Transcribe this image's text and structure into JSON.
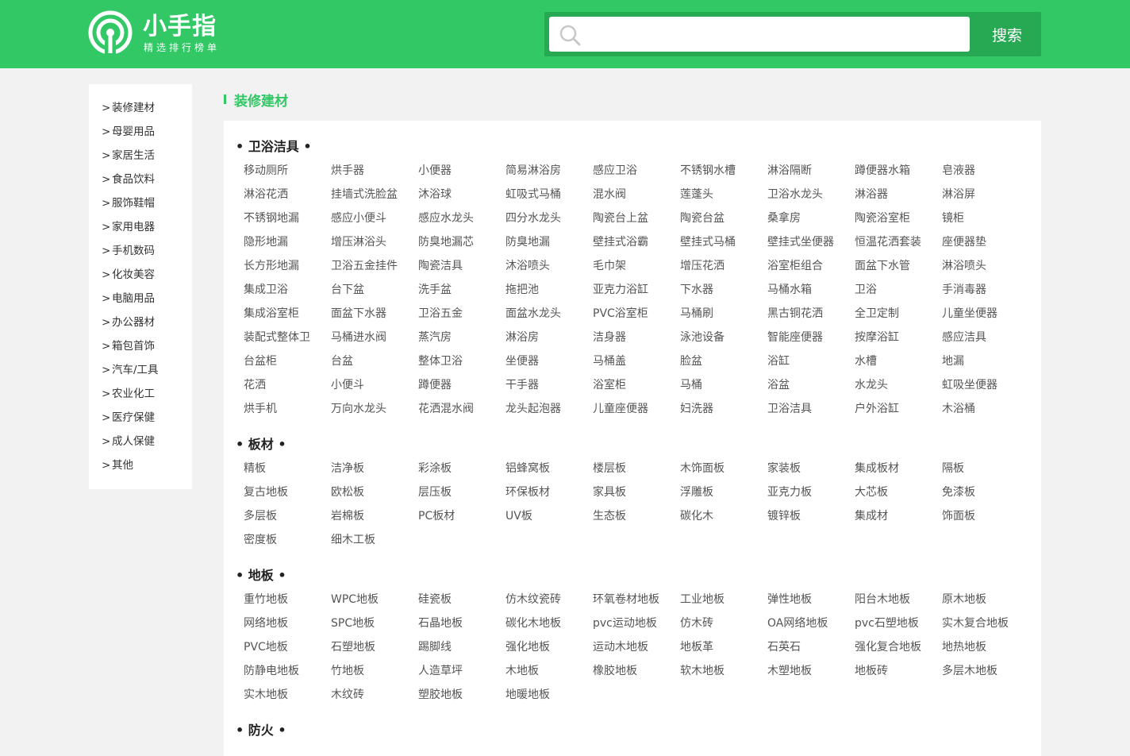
{
  "header": {
    "logo_title": "小手指",
    "logo_subtitle": "精选排行榜单",
    "search_placeholder": "",
    "search_button": "搜索",
    "colors": {
      "brand": "#31c865",
      "brand_dark": "#27a853"
    }
  },
  "sidebar": {
    "chevron": ">",
    "items": [
      "装修建材",
      "母婴用品",
      "家居生活",
      "食品饮料",
      "服饰鞋帽",
      "家用电器",
      "手机数码",
      "化妆美容",
      "电脑用品",
      "办公器材",
      "箱包首饰",
      "汽车/工具",
      "农业化工",
      "医疗保健",
      "成人保健",
      "其他"
    ]
  },
  "category_title": "装修建材",
  "sections": [
    {
      "title": "卫浴洁具",
      "items": [
        "移动厕所",
        "烘手器",
        "小便器",
        "简易淋浴房",
        "感应卫浴",
        "不锈钢水槽",
        "淋浴隔断",
        "蹲便器水箱",
        "皂液器",
        "淋浴花洒",
        "挂墙式洗脸盆",
        "沐浴球",
        "虹吸式马桶",
        "混水阀",
        "莲蓬头",
        "卫浴水龙头",
        "淋浴器",
        "淋浴屏",
        "不锈钢地漏",
        "感应小便斗",
        "感应水龙头",
        "四分水龙头",
        "陶瓷台上盆",
        "陶瓷台盆",
        "桑拿房",
        "陶瓷浴室柜",
        "镜柜",
        "隐形地漏",
        "增压淋浴头",
        "防臭地漏芯",
        "防臭地漏",
        "壁挂式浴霸",
        "壁挂式马桶",
        "壁挂式坐便器",
        "恒温花洒套装",
        "座便器垫",
        "长方形地漏",
        "卫浴五金挂件",
        "陶瓷洁具",
        "沐浴喷头",
        "毛巾架",
        "增压花洒",
        "浴室柜组合",
        "面盆下水管",
        "淋浴喷头",
        "集成卫浴",
        "台下盆",
        "洗手盆",
        "拖把池",
        "亚克力浴缸",
        "下水器",
        "马桶水箱",
        "卫浴",
        "手消毒器",
        "集成浴室柜",
        "面盆下水器",
        "卫浴五金",
        "面盆水龙头",
        "PVC浴室柜",
        "马桶刷",
        "黑古铜花洒",
        "全卫定制",
        "儿童坐便器",
        "装配式整体卫",
        "马桶进水阀",
        "蒸汽房",
        "淋浴房",
        "洁身器",
        "泳池设备",
        "智能座便器",
        "按摩浴缸",
        "感应洁具",
        "台盆柜",
        "台盆",
        "整体卫浴",
        "坐便器",
        "马桶盖",
        "脸盆",
        "浴缸",
        "水槽",
        "地漏",
        "花洒",
        "小便斗",
        "蹲便器",
        "干手器",
        "浴室柜",
        "马桶",
        "浴盆",
        "水龙头",
        "虹吸坐便器",
        "烘手机",
        "万向水龙头",
        "花洒混水阀",
        "龙头起泡器",
        "儿童座便器",
        "妇洗器",
        "卫浴洁具",
        "户外浴缸",
        "木浴桶"
      ]
    },
    {
      "title": "板材",
      "items": [
        "精板",
        "洁净板",
        "彩涂板",
        "铝蜂窝板",
        "楼层板",
        "木饰面板",
        "家装板",
        "集成板材",
        "隔板",
        "复古地板",
        "欧松板",
        "层压板",
        "环保板材",
        "家具板",
        "浮雕板",
        "亚克力板",
        "大芯板",
        "免漆板",
        "多层板",
        "岩棉板",
        "PC板材",
        "UV板",
        "生态板",
        "碳化木",
        "镀锌板",
        "集成材",
        "饰面板",
        "密度板",
        "细木工板"
      ]
    },
    {
      "title": "地板",
      "items": [
        "重竹地板",
        "WPC地板",
        "硅瓷板",
        "仿木纹瓷砖",
        "环氧卷材地板",
        "工业地板",
        "弹性地板",
        "阳台木地板",
        "原木地板",
        "网络地板",
        "SPC地板",
        "石晶地板",
        "碳化木地板",
        "pvc运动地板",
        "仿木砖",
        "OA网络地板",
        "pvc石塑地板",
        "实木复合地板",
        "PVC地板",
        "石塑地板",
        "踢脚线",
        "强化地板",
        "运动木地板",
        "地板革",
        "石英石",
        "强化复合地板",
        "地热地板",
        "防静电地板",
        "竹地板",
        "人造草坪",
        "木地板",
        "橡胶地板",
        "软木地板",
        "木塑地板",
        "地板砖",
        "多层木地板",
        "实木地板",
        "木纹砖",
        "塑胶地板",
        "地暖地板"
      ]
    },
    {
      "title": "防火",
      "items": []
    }
  ]
}
